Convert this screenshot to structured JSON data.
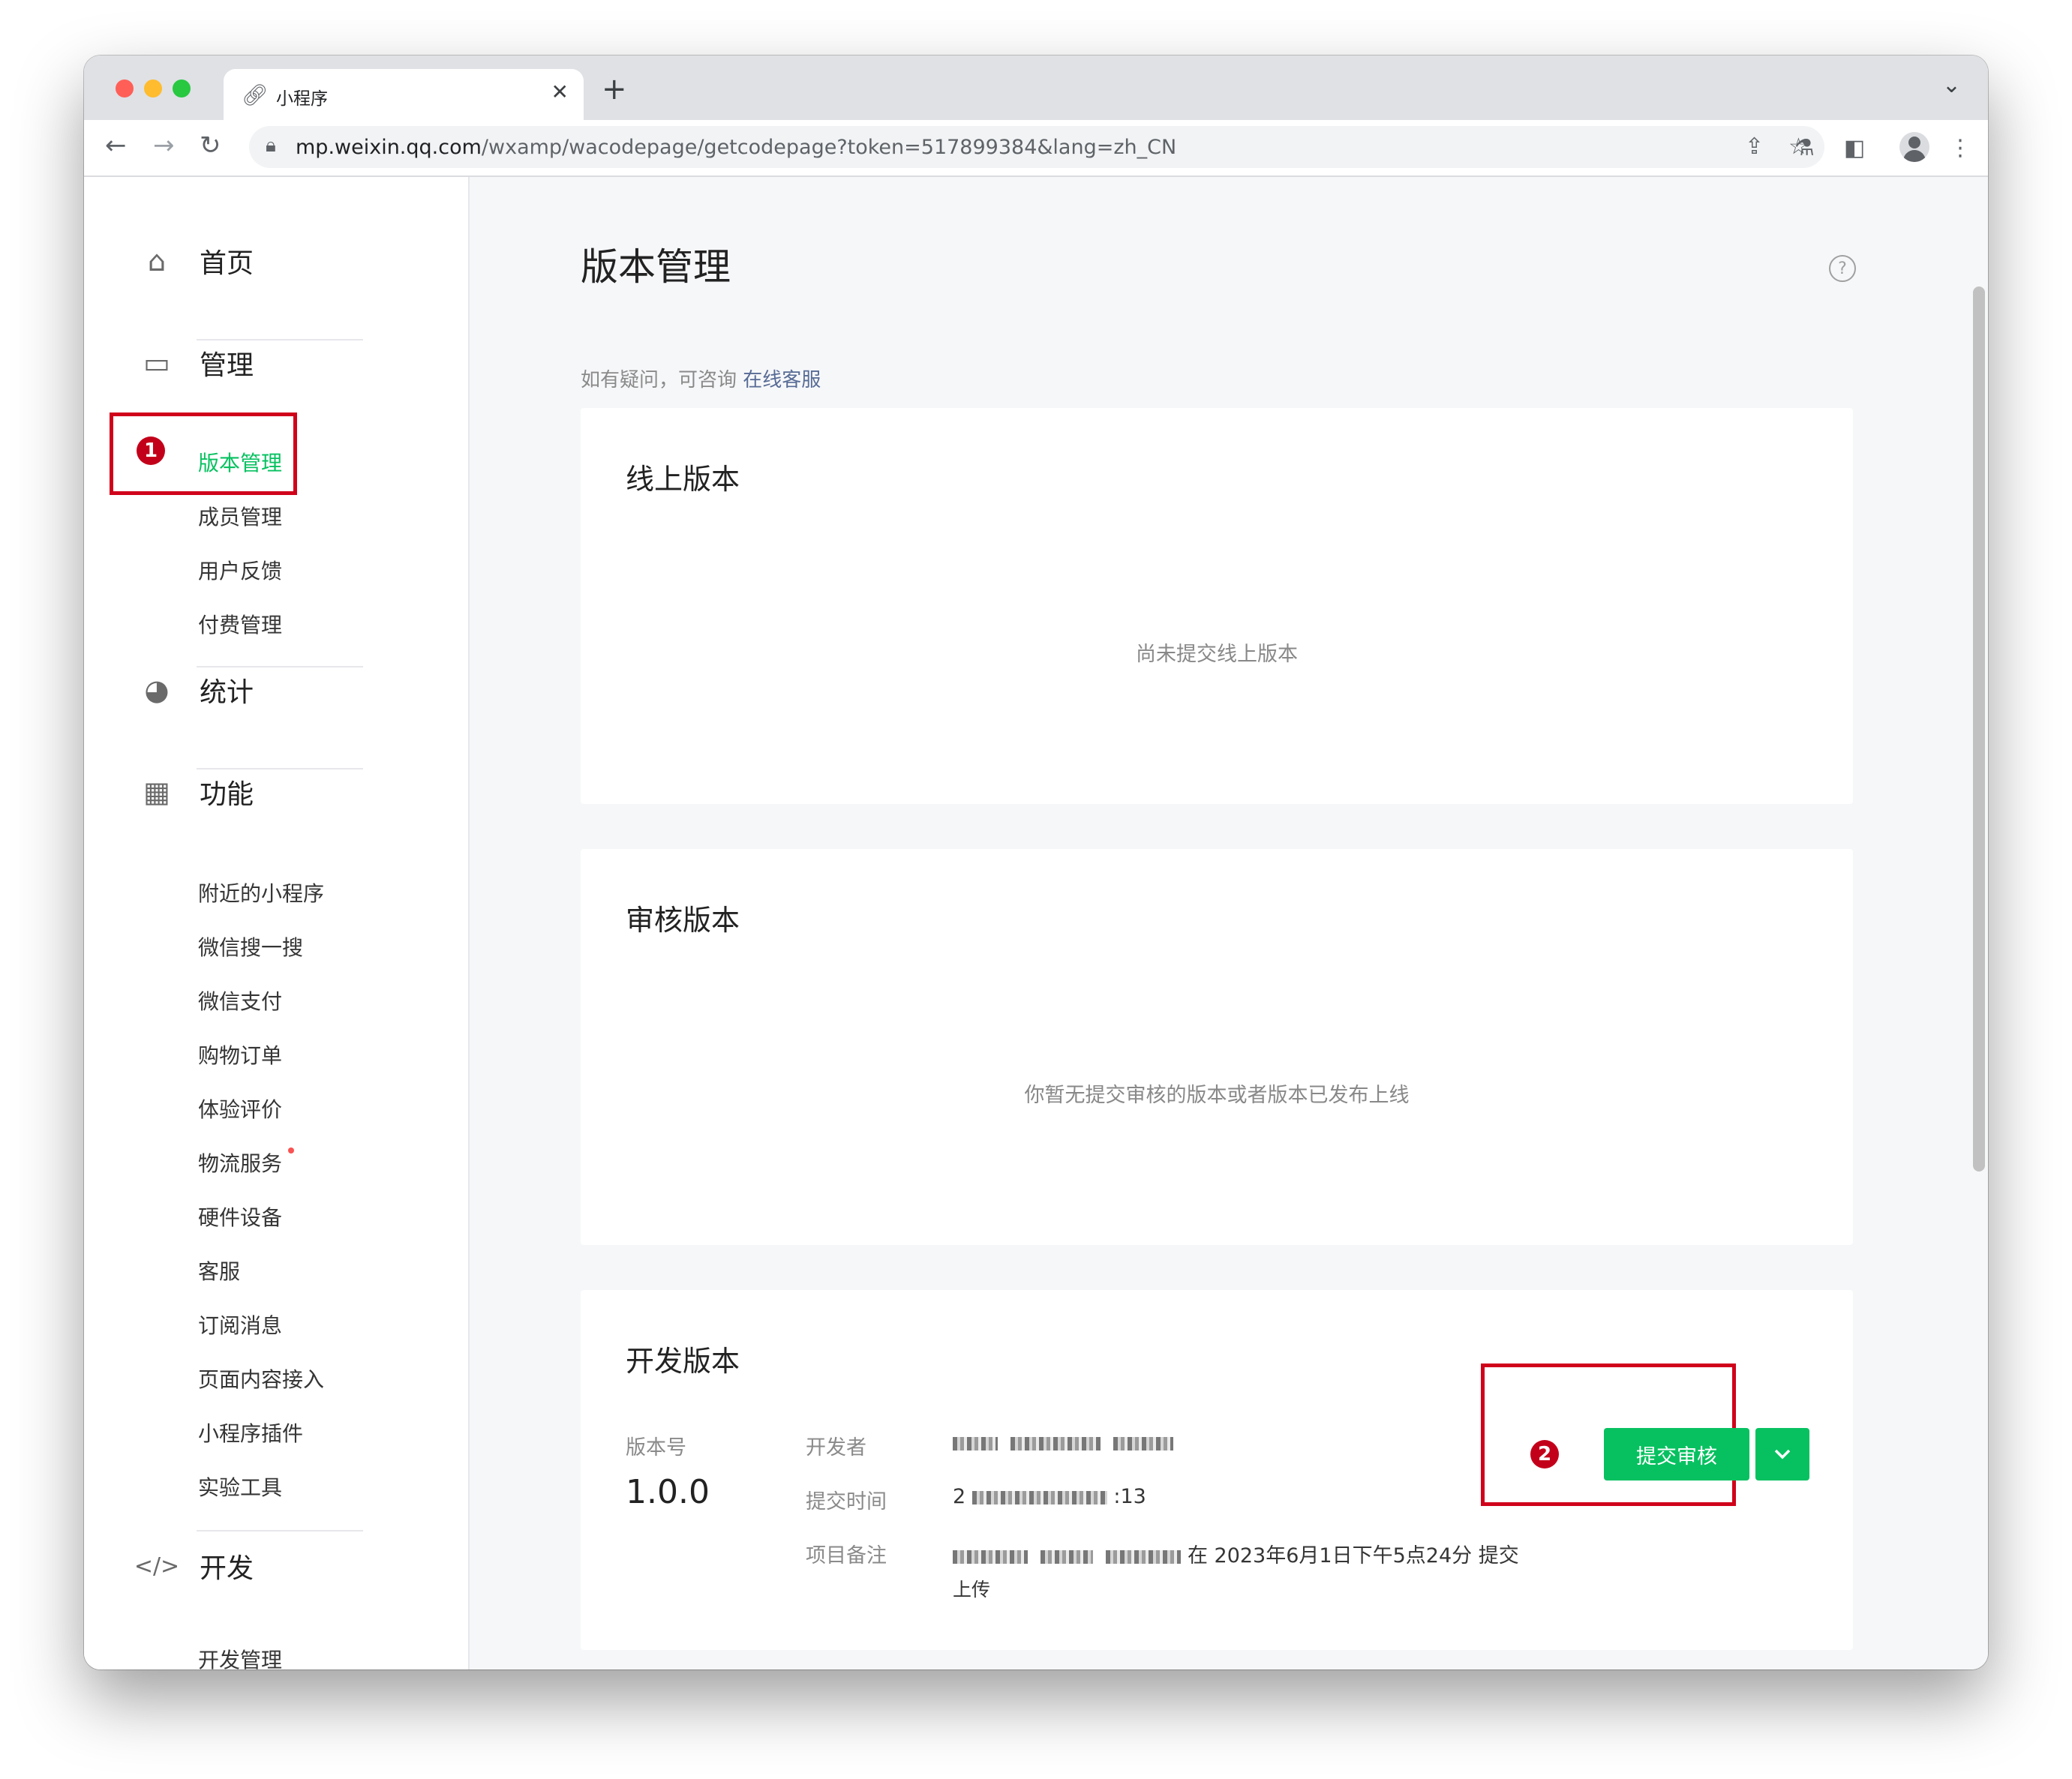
{
  "browser": {
    "tab_title": "小程序",
    "url_host": "mp.weixin.qq.com",
    "url_rest": "/wxamp/wacodepage/getcodepage?token=517899384&lang=zh_CN",
    "traffic_colors": [
      "#ff5f57",
      "#febc2e",
      "#28c840"
    ]
  },
  "sidebar": {
    "home": "首页",
    "manage": {
      "label": "管理",
      "items": [
        "版本管理",
        "成员管理",
        "用户反馈",
        "付费管理"
      ]
    },
    "stats": "统计",
    "features": {
      "label": "功能",
      "items": [
        "附近的小程序",
        "微信搜一搜",
        "微信支付",
        "购物订单",
        "体验评价",
        "物流服务",
        "硬件设备",
        "客服",
        "订阅消息",
        "页面内容接入",
        "小程序插件",
        "实验工具"
      ]
    },
    "dev": {
      "label": "开发",
      "items": [
        "开发管理"
      ]
    }
  },
  "annotations": [
    "1",
    "2"
  ],
  "main": {
    "title": "版本管理",
    "consult_prefix": "如有疑问，可咨询",
    "consult_link": "在线客服",
    "online": {
      "title": "线上版本",
      "empty": "尚未提交线上版本"
    },
    "review": {
      "title": "审核版本",
      "empty": "你暂无提交审核的版本或者版本已发布上线"
    },
    "dev": {
      "title": "开发版本",
      "version_label": "版本号",
      "version": "1.0.0",
      "developer_label": "开发者",
      "time_label": "提交时间",
      "time_prefix": "2",
      "time_suffix": ":13",
      "note_label": "项目备注",
      "note_tail": "在 2023年6月1日下午5点24分 提交",
      "note_line2": "上传",
      "submit_btn": "提交审核"
    }
  },
  "colors": {
    "accent": "#07c160",
    "annotation": "#d0021b",
    "link": "#576b95"
  }
}
